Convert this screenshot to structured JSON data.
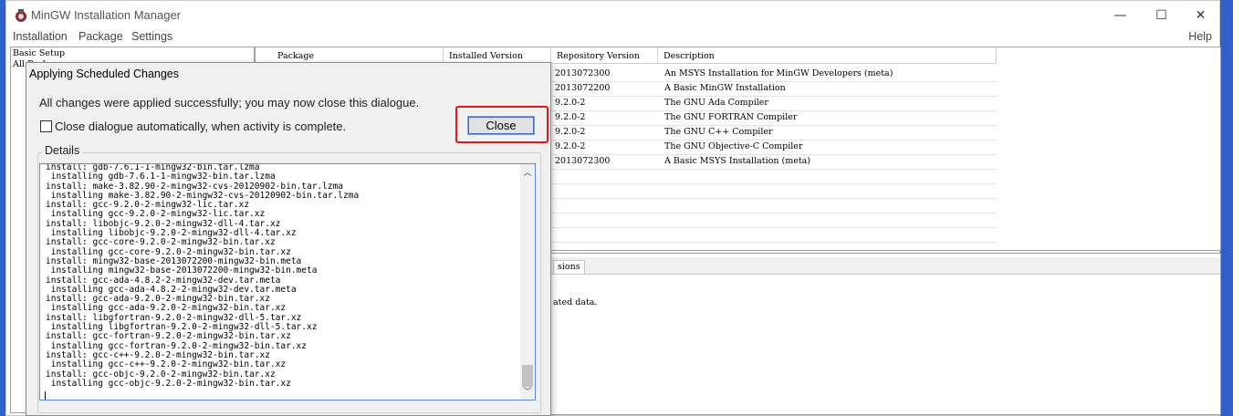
{
  "window": {
    "title": "MinGW Installation Manager",
    "controls": {
      "minimize": "—",
      "maximize": "☐",
      "close": "✕"
    }
  },
  "menu": {
    "installation": "Installation",
    "package": "Package",
    "settings": "Settings",
    "help": "Help"
  },
  "tree": {
    "basic_setup": "Basic Setup",
    "all_packages": "All Packages"
  },
  "grid": {
    "headers": {
      "package": "Package",
      "installed": "Installed Version",
      "repository": "Repository Version",
      "description": "Description"
    },
    "rows": [
      {
        "repo": "2013072300",
        "desc": "An MSYS Installation for MinGW Developers (meta)"
      },
      {
        "repo": "2013072200",
        "desc": "A Basic MinGW Installation"
      },
      {
        "repo": "9.2.0-2",
        "desc": "The GNU Ada Compiler"
      },
      {
        "repo": "9.2.0-2",
        "desc": "The GNU FORTRAN Compiler"
      },
      {
        "repo": "9.2.0-2",
        "desc": "The GNU C++ Compiler"
      },
      {
        "repo": "9.2.0-2",
        "desc": "The GNU Objective-C Compiler"
      },
      {
        "repo": "2013072300",
        "desc": "A Basic MSYS Installation (meta)"
      }
    ]
  },
  "bottom": {
    "tab_partial": "sions",
    "text_partial": "ated data."
  },
  "dialog": {
    "title": "Applying Scheduled Changes",
    "message": "All changes were applied successfully; you may now close this dialogue.",
    "checkbox_label": "Close dialogue automatically, when activity is complete.",
    "close_label": "Close",
    "details_label": "Details",
    "log": [
      "install: gdb-7.6.1-1-mingw32-bin.tar.lzma",
      " installing gdb-7.6.1-1-mingw32-bin.tar.lzma",
      "install: make-3.82.90-2-mingw32-cvs-20120902-bin.tar.lzma",
      " installing make-3.82.90-2-mingw32-cvs-20120902-bin.tar.lzma",
      "install: gcc-9.2.0-2-mingw32-lic.tar.xz",
      " installing gcc-9.2.0-2-mingw32-lic.tar.xz",
      "install: libobjc-9.2.0-2-mingw32-dll-4.tar.xz",
      " installing libobjc-9.2.0-2-mingw32-dll-4.tar.xz",
      "install: gcc-core-9.2.0-2-mingw32-bin.tar.xz",
      " installing gcc-core-9.2.0-2-mingw32-bin.tar.xz",
      "install: mingw32-base-2013072200-mingw32-bin.meta",
      " installing mingw32-base-2013072200-mingw32-bin.meta",
      "install: gcc-ada-4.8.2-2-mingw32-dev.tar.meta",
      " installing gcc-ada-4.8.2-2-mingw32-dev.tar.meta",
      "install: gcc-ada-9.2.0-2-mingw32-bin.tar.xz",
      " installing gcc-ada-9.2.0-2-mingw32-bin.tar.xz",
      "install: libgfortran-9.2.0-2-mingw32-dll-5.tar.xz",
      " installing libgfortran-9.2.0-2-mingw32-dll-5.tar.xz",
      "install: gcc-fortran-9.2.0-2-mingw32-bin.tar.xz",
      " installing gcc-fortran-9.2.0-2-mingw32-bin.tar.xz",
      "install: gcc-c++-9.2.0-2-mingw32-bin.tar.xz",
      " installing gcc-c++-9.2.0-2-mingw32-bin.tar.xz",
      "install: gcc-objc-9.2.0-2-mingw32-bin.tar.xz",
      " installing gcc-objc-9.2.0-2-mingw32-bin.tar.xz"
    ]
  },
  "colors": {
    "highlight": "#e01a1a",
    "accent": "#3b6ec4",
    "desktop": "#2f5fc8"
  }
}
